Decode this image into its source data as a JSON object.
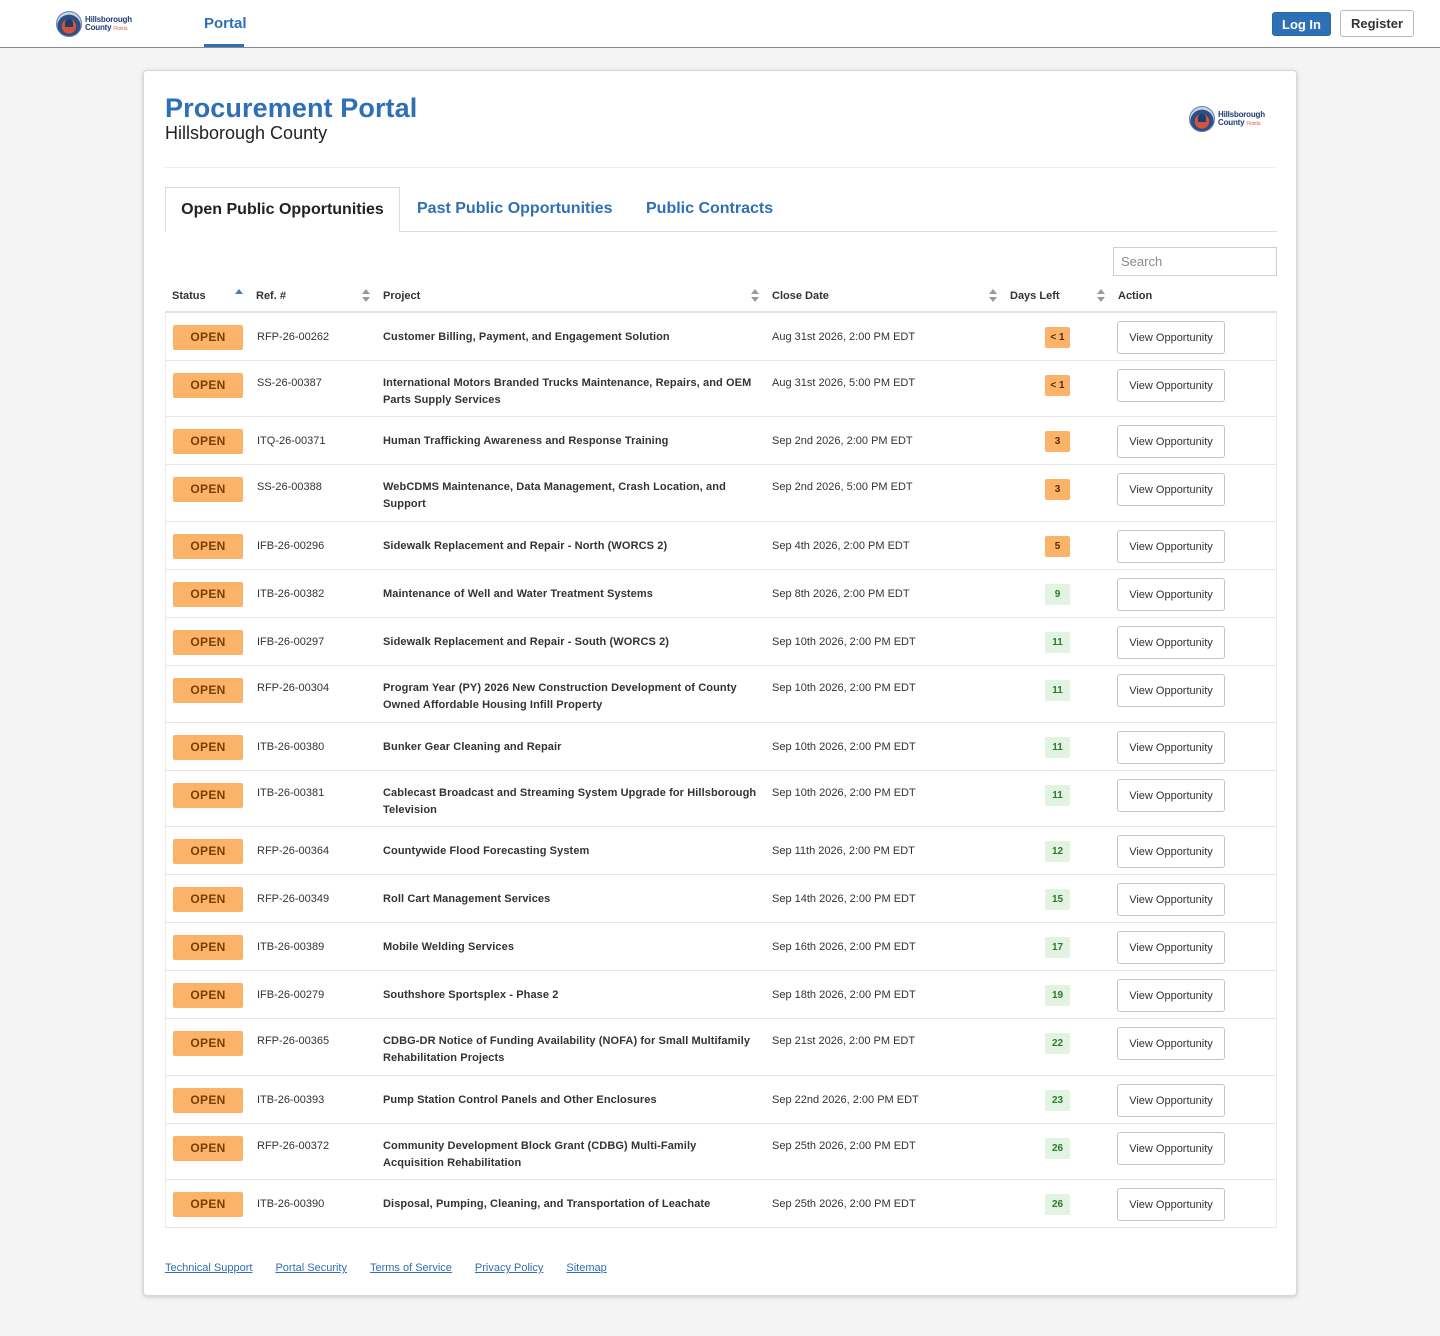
{
  "nav": {
    "logo": {
      "line1": "Hillsborough",
      "line2": "County",
      "line3": "Florida"
    },
    "tab": "Portal",
    "login_label": "Log In",
    "register_label": "Register"
  },
  "header": {
    "title": "Procurement Portal",
    "subtitle": "Hillsborough County"
  },
  "tabs": [
    {
      "label": "Open Public Opportunities",
      "active": true
    },
    {
      "label": "Past Public Opportunities",
      "active": false
    },
    {
      "label": "Public Contracts",
      "active": false
    }
  ],
  "search": {
    "placeholder": "Search",
    "value": ""
  },
  "columns": [
    "Status",
    "Ref. #",
    "Project",
    "Close Date",
    "Days Left",
    "Action"
  ],
  "rows": [
    {
      "status": "OPEN",
      "ref": "RFP-26-00262",
      "project": "Customer Billing, Payment, and Engagement Solution",
      "close": "Aug 31st 2026, 2:00 PM EDT",
      "days": "< 1",
      "urgent": true,
      "action": "View Opportunity"
    },
    {
      "status": "OPEN",
      "ref": "SS-26-00387",
      "project": "International Motors Branded Trucks Maintenance, Repairs, and OEM Parts Supply Services",
      "close": "Aug 31st 2026, 5:00 PM EDT",
      "days": "< 1",
      "urgent": true,
      "action": "View Opportunity"
    },
    {
      "status": "OPEN",
      "ref": "ITQ-26-00371",
      "project": "Human Trafficking Awareness and Response Training",
      "close": "Sep 2nd 2026, 2:00 PM EDT",
      "days": "3",
      "urgent": true,
      "action": "View Opportunity"
    },
    {
      "status": "OPEN",
      "ref": "SS-26-00388",
      "project": "WebCDMS Maintenance, Data Management, Crash Location, and Support",
      "close": "Sep 2nd 2026, 5:00 PM EDT",
      "days": "3",
      "urgent": true,
      "action": "View Opportunity"
    },
    {
      "status": "OPEN",
      "ref": "IFB-26-00296",
      "project": "Sidewalk Replacement and Repair - North (WORCS 2)",
      "close": "Sep 4th 2026, 2:00 PM EDT",
      "days": "5",
      "urgent": true,
      "action": "View Opportunity"
    },
    {
      "status": "OPEN",
      "ref": "ITB-26-00382",
      "project": "Maintenance of Well and Water Treatment Systems",
      "close": "Sep 8th 2026, 2:00 PM EDT",
      "days": "9",
      "urgent": false,
      "action": "View Opportunity"
    },
    {
      "status": "OPEN",
      "ref": "IFB-26-00297",
      "project": "Sidewalk Replacement and Repair - South (WORCS 2)",
      "close": "Sep 10th 2026, 2:00 PM EDT",
      "days": "11",
      "urgent": false,
      "action": "View Opportunity"
    },
    {
      "status": "OPEN",
      "ref": "RFP-26-00304",
      "project": "Program Year (PY) 2026 New Construction Development of County Owned Affordable Housing Infill Property",
      "close": "Sep 10th 2026, 2:00 PM EDT",
      "days": "11",
      "urgent": false,
      "action": "View Opportunity"
    },
    {
      "status": "OPEN",
      "ref": "ITB-26-00380",
      "project": "Bunker Gear Cleaning and Repair",
      "close": "Sep 10th 2026, 2:00 PM EDT",
      "days": "11",
      "urgent": false,
      "action": "View Opportunity"
    },
    {
      "status": "OPEN",
      "ref": "ITB-26-00381",
      "project": "Cablecast Broadcast and Streaming System Upgrade for Hillsborough Television",
      "close": "Sep 10th 2026, 2:00 PM EDT",
      "days": "11",
      "urgent": false,
      "action": "View Opportunity"
    },
    {
      "status": "OPEN",
      "ref": "RFP-26-00364",
      "project": "Countywide Flood Forecasting System",
      "close": "Sep 11th 2026, 2:00 PM EDT",
      "days": "12",
      "urgent": false,
      "action": "View Opportunity"
    },
    {
      "status": "OPEN",
      "ref": "RFP-26-00349",
      "project": "Roll Cart Management Services",
      "close": "Sep 14th 2026, 2:00 PM EDT",
      "days": "15",
      "urgent": false,
      "action": "View Opportunity"
    },
    {
      "status": "OPEN",
      "ref": "ITB-26-00389",
      "project": "Mobile Welding Services",
      "close": "Sep 16th 2026, 2:00 PM EDT",
      "days": "17",
      "urgent": false,
      "action": "View Opportunity"
    },
    {
      "status": "OPEN",
      "ref": "IFB-26-00279",
      "project": "Southshore Sportsplex - Phase 2",
      "close": "Sep 18th 2026, 2:00 PM EDT",
      "days": "19",
      "urgent": false,
      "action": "View Opportunity"
    },
    {
      "status": "OPEN",
      "ref": "RFP-26-00365",
      "project": "CDBG-DR Notice of Funding Availability (NOFA) for Small Multifamily Rehabilitation Projects",
      "close": "Sep 21st 2026, 2:00 PM EDT",
      "days": "22",
      "urgent": false,
      "action": "View Opportunity"
    },
    {
      "status": "OPEN",
      "ref": "ITB-26-00393",
      "project": "Pump Station Control Panels and Other Enclosures",
      "close": "Sep 22nd 2026, 2:00 PM EDT",
      "days": "23",
      "urgent": false,
      "action": "View Opportunity"
    },
    {
      "status": "OPEN",
      "ref": "RFP-26-00372",
      "project": "Community Development Block Grant (CDBG) Multi-Family Acquisition Rehabilitation",
      "close": "Sep 25th 2026, 2:00 PM EDT",
      "days": "26",
      "urgent": false,
      "action": "View Opportunity"
    },
    {
      "status": "OPEN",
      "ref": "ITB-26-00390",
      "project": "Disposal, Pumping, Cleaning, and Transportation of Leachate",
      "close": "Sep 25th 2026, 2:00 PM EDT",
      "days": "26",
      "urgent": false,
      "action": "View Opportunity"
    }
  ],
  "footer": [
    "Technical Support",
    "Portal Security",
    "Terms of Service",
    "Privacy Policy",
    "Sitemap"
  ],
  "colors": {
    "accent": "#2f6fb6",
    "open_badge": "#fbb36a",
    "days_green": "#e2f3e2"
  }
}
